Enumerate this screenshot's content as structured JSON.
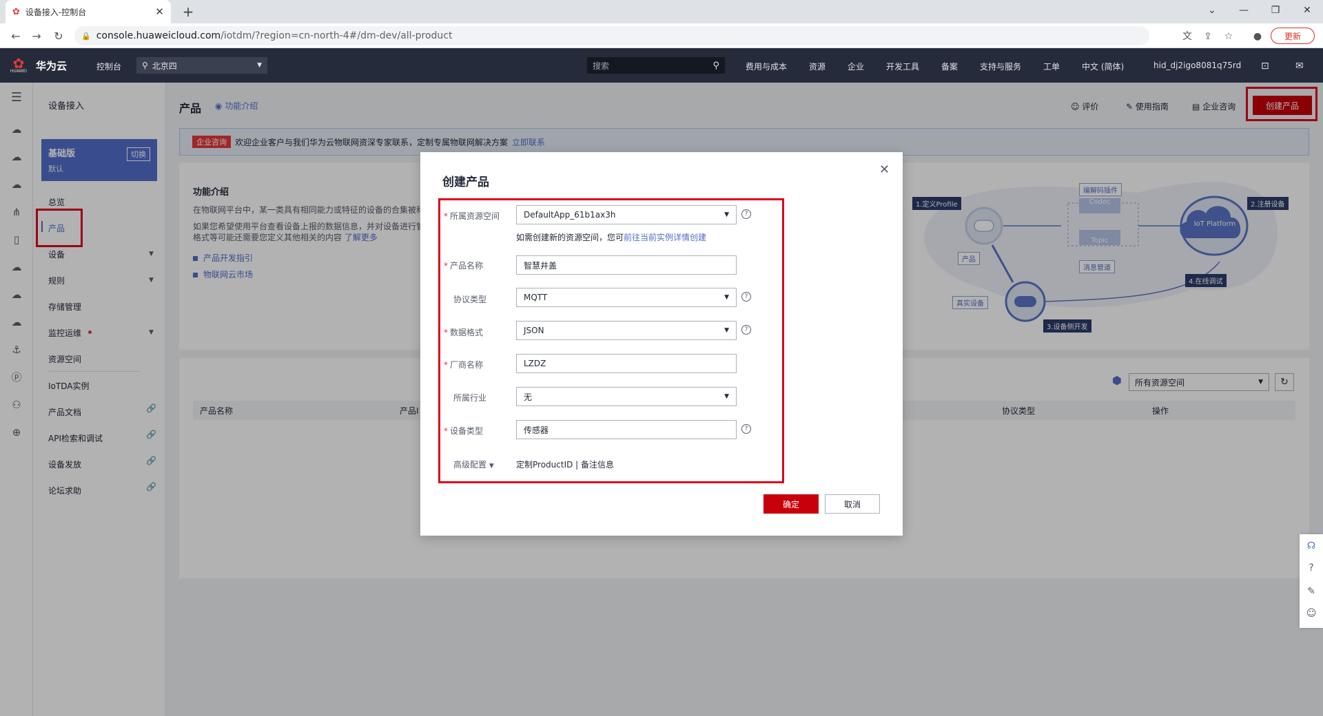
{
  "browser": {
    "tab_title": "设备接入-控制台",
    "url_host": "console.huaweicloud.com",
    "url_path": "/iotdm/?region=cn-north-4#/dm-dev/all-product",
    "update_label": "更新"
  },
  "topbar": {
    "logo_text": "HUAWEI",
    "brand": "华为云",
    "console": "控制台",
    "region": "北京四",
    "search_placeholder": "搜索",
    "nav": [
      "费用与成本",
      "资源",
      "企业",
      "开发工具",
      "备案",
      "支持与服务",
      "工单",
      "中文 (简体)",
      "hid_dj2igo8081q75rd"
    ]
  },
  "sidebar": {
    "title": "设备接入",
    "edition_name": "基础版",
    "edition_desc": "默认",
    "switch_label": "切换",
    "items": [
      "总览",
      "产品",
      "设备",
      "规则",
      "存储管理",
      "监控运维",
      "资源空间",
      "IoTDA实例",
      "产品文档",
      "API检索和调试",
      "设备发放",
      "论坛求助"
    ]
  },
  "header": {
    "title": "产品",
    "intro_link": "功能介绍",
    "actions": [
      "评价",
      "使用指南",
      "企业咨询"
    ],
    "create_button": "创建产品"
  },
  "banner": {
    "tag": "企业咨询",
    "text": "欢迎企业客户与我们华为云物联网资深专家联系，定制专属物联网解决方案",
    "link": "立即联系"
  },
  "intro": {
    "title": "功能介绍",
    "line1": "在物联网平台中，某一类具有相同能力或特征的设备的合集被称",
    "line2": "如果您希望使用平台查看设备上报的数据信息，并对设备进行管",
    "line3": "格式等可能还需要您定义其他相关的内容",
    "line3_link": "了解更多",
    "links": [
      "产品开发指引",
      "物联网云市场"
    ]
  },
  "diagram": {
    "step1": "1.定义Profile",
    "step2": "2.注册设备",
    "step3": "3.设备侧开发",
    "step4": "4.在线调试",
    "codec_plugin": "编解码插件",
    "codec": "Codec",
    "topic": "Topic",
    "msg_pipe": "消息管道",
    "product": "产品",
    "real_device": "真实设备",
    "platform": "IoT Platform"
  },
  "table": {
    "resource_select": "所有资源空间",
    "headers": [
      "产品名称",
      "产品I",
      "协议类型",
      "操作"
    ]
  },
  "modal": {
    "title": "创建产品",
    "fields": [
      {
        "label": "所属资源空间",
        "value": "DefaultApp_61b1ax3h",
        "required": true
      },
      {
        "label": "产品名称",
        "value": "智慧井盖",
        "required": true
      },
      {
        "label": "协议类型",
        "value": "MQTT",
        "required": false
      },
      {
        "label": "数据格式",
        "value": "JSON",
        "required": true
      },
      {
        "label": "厂商名称",
        "value": "LZDZ",
        "required": true
      },
      {
        "label": "所属行业",
        "value": "无",
        "required": false
      },
      {
        "label": "设备类型",
        "value": "传感器",
        "required": true
      }
    ],
    "hint_text": "如需创建新的资源空间，您可",
    "hint_link": "前往当前实例详情创建",
    "advanced": "高级配置",
    "advanced_links": "定制ProductID | 备注信息",
    "ok": "确定",
    "cancel": "取消"
  },
  "colors": {
    "accent": "#526ecc",
    "brand_red": "#c7000b",
    "highlight_red": "#e0001b",
    "topbar": "#252b3a"
  }
}
